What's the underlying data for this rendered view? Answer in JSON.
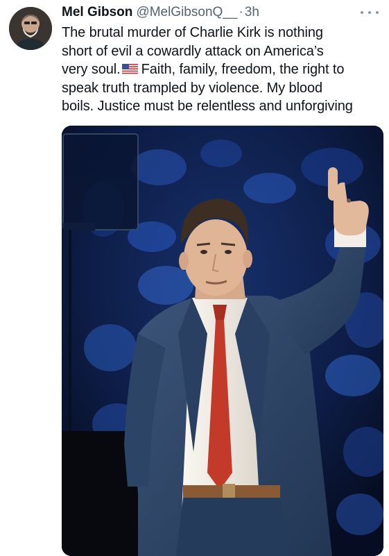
{
  "tweet": {
    "author": {
      "display_name": "Mel Gibson",
      "handle": "@MelGibsonQ__",
      "separator": "·",
      "time": "3h",
      "avatar_icon": "user-avatar"
    },
    "text_lines": [
      "The brutal murder of Charlie Kirk is nothing",
      "short of evil a cowardly attack on America’s",
      "very soul.",
      "Faith, family, freedom, the right to",
      "speak truth trampled by violence. My blood",
      "boils. Justice must be relentless and unforgiving"
    ],
    "flag_icon": "us-flag-emoji",
    "more_icon": "more-options-icon",
    "media": {
      "type": "photo"
    }
  },
  "colors": {
    "text_primary": "#0f1419",
    "text_secondary": "#536471",
    "photo_background": "#0c1a3f",
    "suit": "#2f4566",
    "tie": "#c43a2a",
    "shirt": "#f2efe9"
  }
}
